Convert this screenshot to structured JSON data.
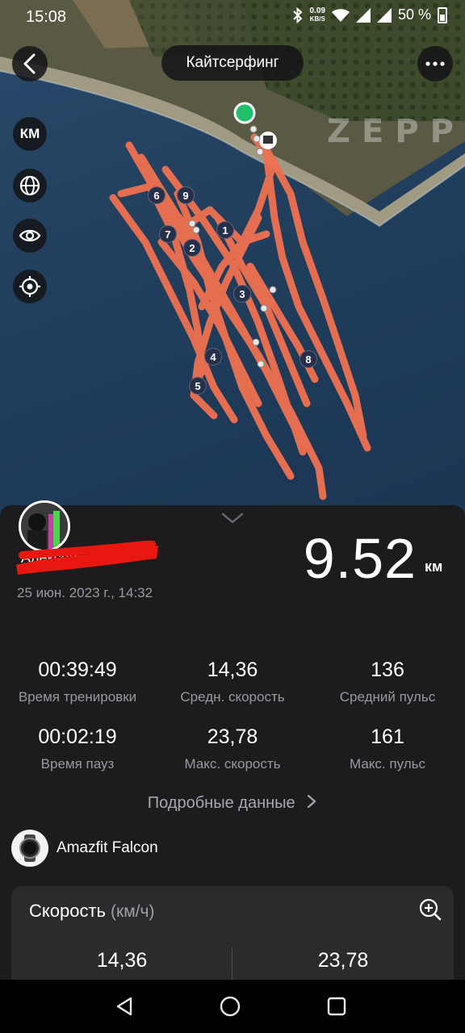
{
  "status_bar": {
    "time": "15:08",
    "net_speed_value": "0.09",
    "net_speed_unit": "KB/S",
    "battery": "50 %"
  },
  "header": {
    "title": "Кайтсерфинг",
    "back_icon": "chevron-left-icon",
    "more_icon": "more-horizontal-icon"
  },
  "map": {
    "watermark": "ZEPP",
    "tools": {
      "units_label": "КМ",
      "globe_icon": "globe-icon",
      "eye_icon": "eye-icon",
      "locate_icon": "crosshair-icon"
    },
    "route_color": "#f07050",
    "start_color": "#22c06a",
    "lap_markers": [
      "1",
      "2",
      "3",
      "4",
      "5",
      "6",
      "7",
      "8",
      "9"
    ]
  },
  "workout": {
    "user_name": "Алексей",
    "date": "25 июн. 2023 г., 14:32",
    "distance_value": "9.52",
    "distance_unit": "км",
    "stats": {
      "time_value": "00:39:49",
      "time_label": "Время тренировки",
      "avg_speed_value": "14,36",
      "avg_speed_label": "Средн. скорость",
      "avg_hr_value": "136",
      "avg_hr_label": "Средний пульс",
      "pause_value": "00:02:19",
      "pause_label": "Время пауз",
      "max_speed_value": "23,78",
      "max_speed_label": "Макс. скорость",
      "max_hr_value": "161",
      "max_hr_label": "Макс. пульс"
    },
    "details_label": "Подробные данные",
    "device_name": "Amazfit Falcon"
  },
  "speed_card": {
    "title": "Скорость",
    "unit": "(км/ч)",
    "avg": "14,36",
    "max": "23,78"
  },
  "nav_bar": {
    "back_icon": "triangle-back-icon",
    "home_icon": "circle-home-icon",
    "recents_icon": "square-recents-icon"
  }
}
